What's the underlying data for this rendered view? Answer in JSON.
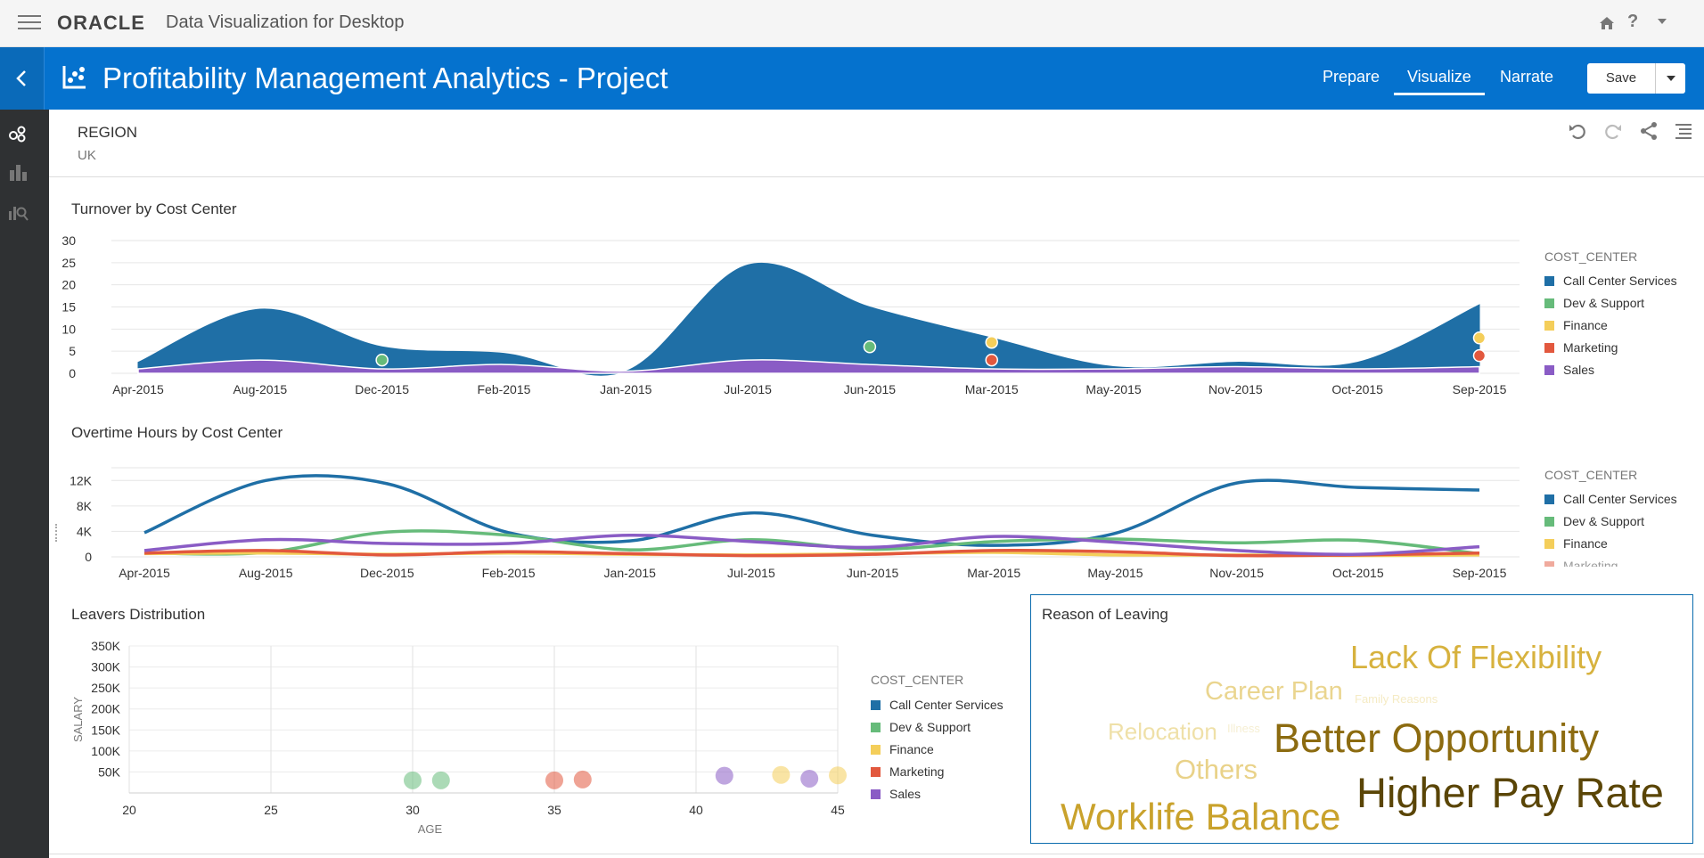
{
  "app": {
    "brand": "ORACLE",
    "product": "Data Visualization for Desktop"
  },
  "header": {
    "project_title": "Profitability Management Analytics - Project",
    "nav": [
      "Prepare",
      "Visualize",
      "Narrate"
    ],
    "active_nav": "Visualize",
    "save_label": "Save"
  },
  "filter": {
    "label": "REGION",
    "value": "UK"
  },
  "colors": {
    "accent": "#0572ce",
    "call_center": "#1f6fa6",
    "dev_support": "#66bb7a",
    "finance": "#f4ce5a",
    "marketing": "#e2583e",
    "sales": "#8a5cc5"
  },
  "legend": {
    "title": "COST_CENTER",
    "items": [
      "Call Center Services",
      "Dev & Support",
      "Finance",
      "Marketing",
      "Sales"
    ]
  },
  "chart_data": [
    {
      "type": "area",
      "title": "Turnover by Cost Center",
      "categories": [
        "Apr-2015",
        "Aug-2015",
        "Dec-2015",
        "Feb-2015",
        "Jan-2015",
        "Jul-2015",
        "Jun-2015",
        "Mar-2015",
        "May-2015",
        "Nov-2015",
        "Oct-2015",
        "Sep-2015"
      ],
      "y_ticks": [
        0,
        5,
        10,
        15,
        20,
        25,
        30
      ],
      "ylim": [
        0,
        30
      ],
      "series": [
        {
          "name": "Call Center Services",
          "values": [
            2.5,
            14.5,
            6,
            4.5,
            0.5,
            24.5,
            15,
            8,
            1.5,
            2.5,
            2.5,
            15.5
          ]
        },
        {
          "name": "Sales",
          "values": [
            1,
            3,
            1,
            2,
            0.5,
            3,
            2,
            1,
            1,
            1.5,
            1,
            1.5
          ]
        }
      ],
      "points": [
        {
          "series": "Dev & Support",
          "x": "Dec-2015",
          "y": 3
        },
        {
          "series": "Dev & Support",
          "x": "Jun-2015",
          "y": 6
        },
        {
          "series": "Finance",
          "x": "Mar-2015",
          "y": 7
        },
        {
          "series": "Marketing",
          "x": "Mar-2015",
          "y": 3
        },
        {
          "series": "Finance",
          "x": "Sep-2015",
          "y": 8
        },
        {
          "series": "Marketing",
          "x": "Sep-2015",
          "y": 4
        }
      ],
      "grid": true,
      "legend_position": "right"
    },
    {
      "type": "line",
      "title": "Overtime Hours by Cost Center",
      "categories": [
        "Apr-2015",
        "Aug-2015",
        "Dec-2015",
        "Feb-2015",
        "Jan-2015",
        "Jul-2015",
        "Jun-2015",
        "Mar-2015",
        "May-2015",
        "Nov-2015",
        "Oct-2015",
        "Sep-2015"
      ],
      "y_tick_labels": [
        "0",
        "4K",
        "8K",
        "12K"
      ],
      "y_ticks": [
        0,
        4000,
        8000,
        12000
      ],
      "ylim": [
        0,
        14000
      ],
      "series": [
        {
          "name": "Call Center Services",
          "values": [
            3800,
            12000,
            11500,
            3800,
            2500,
            6900,
            3400,
            1800,
            3700,
            11600,
            10900,
            10500
          ]
        },
        {
          "name": "Dev & Support",
          "values": [
            600,
            700,
            3900,
            3400,
            1100,
            2700,
            1200,
            2400,
            2800,
            2200,
            2600,
            500
          ]
        },
        {
          "name": "Finance",
          "values": [
            500,
            600,
            400,
            600,
            400,
            300,
            500,
            700,
            300,
            300,
            200,
            300
          ]
        },
        {
          "name": "Marketing",
          "values": [
            600,
            1000,
            300,
            800,
            500,
            200,
            400,
            1000,
            800,
            200,
            300,
            600
          ]
        },
        {
          "name": "Sales",
          "values": [
            1000,
            2700,
            2100,
            2100,
            3400,
            2400,
            1500,
            3200,
            2300,
            1000,
            400,
            1600
          ]
        }
      ],
      "legend_items": [
        "Call Center Services",
        "Dev & Support",
        "Finance",
        "Marketing"
      ],
      "grid": true,
      "legend_position": "right"
    },
    {
      "type": "scatter",
      "title": "Leavers Distribution",
      "xlabel": "AGE",
      "ylabel": "SALARY",
      "x_ticks": [
        20,
        25,
        30,
        35,
        40,
        45
      ],
      "xlim": [
        20,
        45
      ],
      "y_tick_labels": [
        "50K",
        "100K",
        "150K",
        "200K",
        "250K",
        "300K",
        "350K"
      ],
      "y_ticks": [
        50000,
        100000,
        150000,
        200000,
        250000,
        300000,
        350000
      ],
      "ylim": [
        0,
        350000
      ],
      "points": [
        {
          "series": "Dev & Support",
          "x": 30,
          "y": 30000
        },
        {
          "series": "Dev & Support",
          "x": 31,
          "y": 30000
        },
        {
          "series": "Marketing",
          "x": 35,
          "y": 30000
        },
        {
          "series": "Marketing",
          "x": 36,
          "y": 32000
        },
        {
          "series": "Sales",
          "x": 41,
          "y": 41000
        },
        {
          "series": "Finance",
          "x": 43,
          "y": 43000
        },
        {
          "series": "Sales",
          "x": 44,
          "y": 34000
        },
        {
          "series": "Finance",
          "x": 45,
          "y": 42000
        }
      ],
      "grid": true,
      "legend_position": "right"
    }
  ],
  "wordcloud": {
    "title": "Reason of Leaving",
    "words": [
      {
        "text": "Lack Of Flexibility",
        "color": "#d7b23e"
      },
      {
        "text": "Career Plan",
        "color": "#ead58f"
      },
      {
        "text": "Family Reasons",
        "color": "#f5ebc4"
      },
      {
        "text": "Relocation",
        "color": "#efe0a8"
      },
      {
        "text": "Illness",
        "color": "#f6efd3"
      },
      {
        "text": "Better Opportunity",
        "color": "#8c6b10"
      },
      {
        "text": "Others",
        "color": "#e9d289"
      },
      {
        "text": "Higher Pay Rate",
        "color": "#5a4506"
      },
      {
        "text": "Worklife Balance",
        "color": "#c9a22c"
      }
    ]
  }
}
